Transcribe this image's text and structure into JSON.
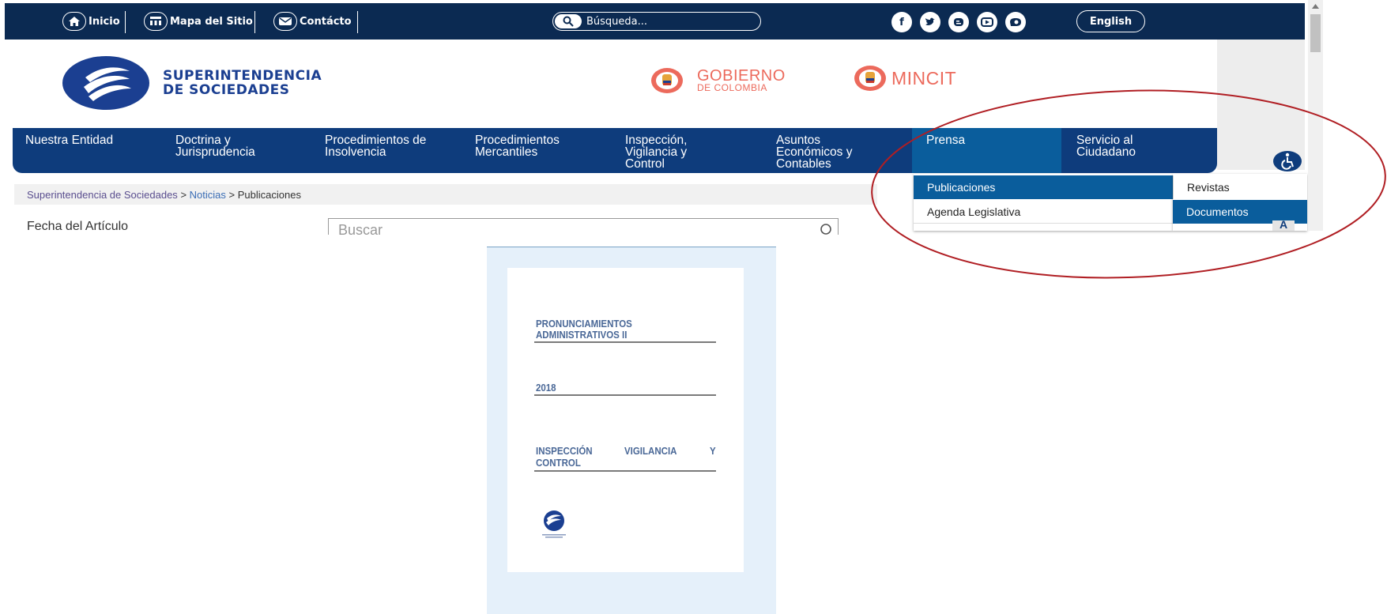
{
  "utility_bar": {
    "home_label": "Inicio",
    "sitemap_label": "Mapa del Sitio",
    "contact_label": "Contácto",
    "search_placeholder": "Búsqueda...",
    "social_icons": [
      "facebook-icon",
      "twitter-icon",
      "blogger-icon",
      "youtube-icon",
      "issuu-icon"
    ],
    "language_label": "English"
  },
  "header": {
    "org_name_line1": "SUPERINTENDENCIA",
    "org_name_line2": "DE SOCIEDADES",
    "gov_logo_line1": "GOBIERNO",
    "gov_logo_line2": "DE COLOMBIA",
    "mincit_label": "MINCIT"
  },
  "main_nav": {
    "items": [
      {
        "label": "Nuestra Entidad"
      },
      {
        "label": "Doctrina y\nJurisprudencia"
      },
      {
        "label": "Procedimientos de\nInsolvencia"
      },
      {
        "label": "Procedimientos\nMercantiles"
      },
      {
        "label": "Inspección,\nVigilancia y\nControl"
      },
      {
        "label": "Asuntos\nEconómicos y\nContables"
      },
      {
        "label": "Prensa"
      },
      {
        "label": "Servicio al\nCiudadano"
      }
    ]
  },
  "breadcrumb": {
    "root": "Superintendencia de Sociedades",
    "separator": ">",
    "middle": "Noticias",
    "current": "Publicaciones"
  },
  "filters": {
    "date_label": "Fecha del Artículo",
    "search_placeholder": "Buscar"
  },
  "dropdown": {
    "items": [
      "Publicaciones",
      "Agenda Legislativa"
    ],
    "sub_items": [
      "Revistas",
      "Documentos"
    ]
  },
  "font_size_button": "A",
  "document_cover": {
    "title_line1": "PRONUNCIAMIENTOS",
    "title_line2": "ADMINISTRATIVOS II",
    "year": "2018",
    "section_line1": "INSPECCIÓN",
    "section_word2": "VIGILANCIA",
    "section_word3": "Y",
    "section_line2": "CONTROL"
  },
  "colors": {
    "topbar_bg": "#0b2a52",
    "nav_bg": "#0e3c7c",
    "nav_active_bg": "#0a5d9c",
    "brand_blue": "#1b3f91",
    "gov_orange": "#ec6a5c",
    "annotation_red": "#b01e23",
    "doc_panel_bg": "#e5f0fa"
  }
}
